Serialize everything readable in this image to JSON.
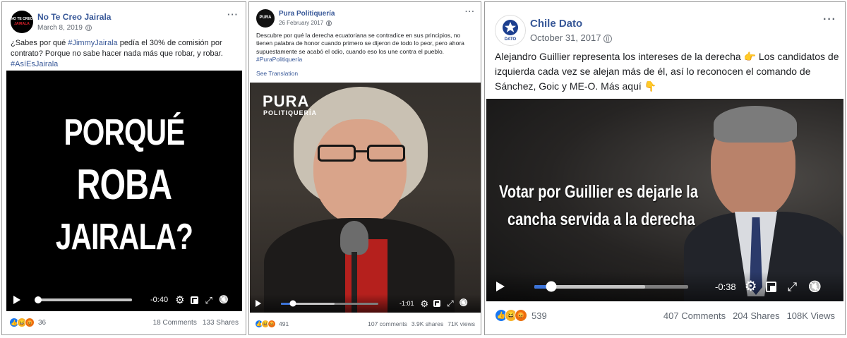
{
  "posts": [
    {
      "page_name": "No Te Creo Jairala",
      "avatar_text": "NO TE CREO",
      "avatar_sub": "JAIRALA",
      "date": "March 8, 2019",
      "text_before": "¿Sabes por qué ",
      "hashtag1": "#JimmyJairala",
      "text_after": " pedía el 30% de comisión por contrato? Porque no sabe hacer nada más que robar, y robar.",
      "hashtag2": "#AsíEsJairala",
      "video_lines": [
        "PORQUÉ",
        "ROBA",
        "JAIRALA?"
      ],
      "time_remaining": "-0:40",
      "progress": 0.02,
      "reaction_count": "36",
      "comments": "18 Comments",
      "shares": "133 Shares"
    },
    {
      "page_name": "Pura Politiquería",
      "avatar_text": "PURA",
      "date": "26 February 2017",
      "text": "Descubre por qué la derecha ecuatoriana se contradice en sus principios, no tienen palabra de honor cuando primero se dijeron de todo lo peor, pero ahora supuestamente se acabó el odio, cuando eso los une contra el pueblo. ",
      "hashtag": "#PuraPolitiquería",
      "see_translation": "See Translation",
      "watermark_line1": "PURA",
      "watermark_line2": "POLITIQUERÍA",
      "time_remaining": "-1:01",
      "progress": 0.12,
      "reaction_count": "491",
      "comments": "107 comments",
      "shares": "3.9K shares",
      "views": "71K views"
    },
    {
      "page_name": "Chile Dato",
      "avatar_text": "DATO",
      "date": "October 31, 2017",
      "text": "Alejandro Guillier representa los intereses de la derecha 👉 Los candidatos de izquierda cada vez se alejan más de él, así lo reconocen el comando de Sánchez, Goic y ME-O. Más aquí 👇",
      "video_lines": [
        "Votar por Guillier es dejarle la",
        "cancha servida a la derecha"
      ],
      "time_remaining": "-0:38",
      "progress": 0.11,
      "reaction_count": "539",
      "comments": "407 Comments",
      "shares": "204 Shares",
      "views": "108K Views"
    }
  ],
  "icons": {
    "more": "···",
    "settings": "⚙",
    "fullscreen": "⤢",
    "mute": "🔇"
  },
  "colors": {
    "link": "#385898",
    "progress": "#3b73d9",
    "like": "#1877f2",
    "haha": "#f7b125",
    "angry": "#e9710f"
  }
}
